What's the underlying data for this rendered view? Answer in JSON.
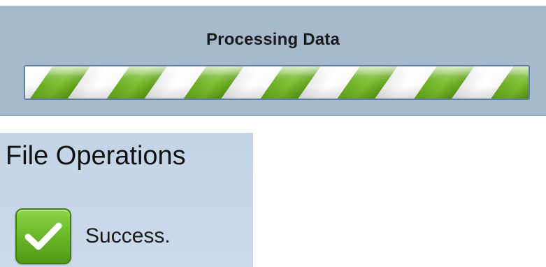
{
  "processing": {
    "title": "Processing Data",
    "progress_fraction": 1.0,
    "colors": {
      "panel_bg": "#a6b9cc",
      "stripe_green": "#6aad22",
      "stripe_white": "#ffffff",
      "track_border": "#5d7f9e"
    }
  },
  "file_operations": {
    "title": "File Operations",
    "status": {
      "icon": "checkmark-icon",
      "text": "Success.",
      "color": "#6cba2a"
    }
  }
}
